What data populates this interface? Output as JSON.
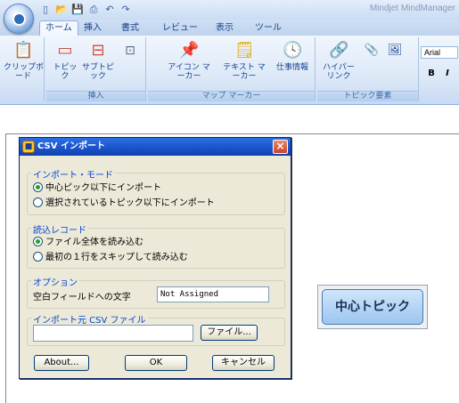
{
  "app": {
    "title": "Mindjet MindManager",
    "quick_access": [
      "new-doc-icon",
      "open-icon",
      "save-icon",
      "print-icon",
      "undo-icon",
      "redo-icon"
    ]
  },
  "tabs": [
    "ホーム",
    "挿入",
    "書式",
    "レビュー",
    "表示",
    "ツール"
  ],
  "active_tab": "ホーム",
  "ribbon": {
    "groups": [
      {
        "label": "",
        "buttons": [
          "クリップボ\nード"
        ]
      },
      {
        "label": "挿入",
        "buttons": [
          "トピック",
          "サブトピ\nック"
        ]
      },
      {
        "label": "マップ マーカー",
        "buttons": [
          "アイコン マ\nーカー",
          "テキスト マ\nーカー",
          "仕事情報"
        ]
      },
      {
        "label": "トピック要素",
        "buttons": [
          "ハイパー\nリンク"
        ]
      }
    ],
    "font_name": "Arial",
    "bold_label": "B",
    "italic_label": "I"
  },
  "dialog": {
    "title": "CSV インポート",
    "import_mode": {
      "legend": "インポート・モード",
      "options": [
        "中心ピック以下にインポート",
        "選択されているトピック以下にインポート"
      ],
      "selected": 0
    },
    "read_records": {
      "legend": "読込レコード",
      "options": [
        "ファイル全体を読み込む",
        "最初の１行をスキップして読み込む"
      ],
      "selected": 0
    },
    "options": {
      "legend": "オプション",
      "empty_field_label": "空白フィールドへの文字",
      "empty_field_value": "Not Assigned"
    },
    "source": {
      "legend": "インポート元 CSV ファイル",
      "path_value": "",
      "file_button": "ファイル..."
    },
    "buttons": {
      "about": "About...",
      "ok": "OK",
      "cancel": "キャンセル"
    }
  },
  "canvas": {
    "central_topic": "中心トピック"
  }
}
